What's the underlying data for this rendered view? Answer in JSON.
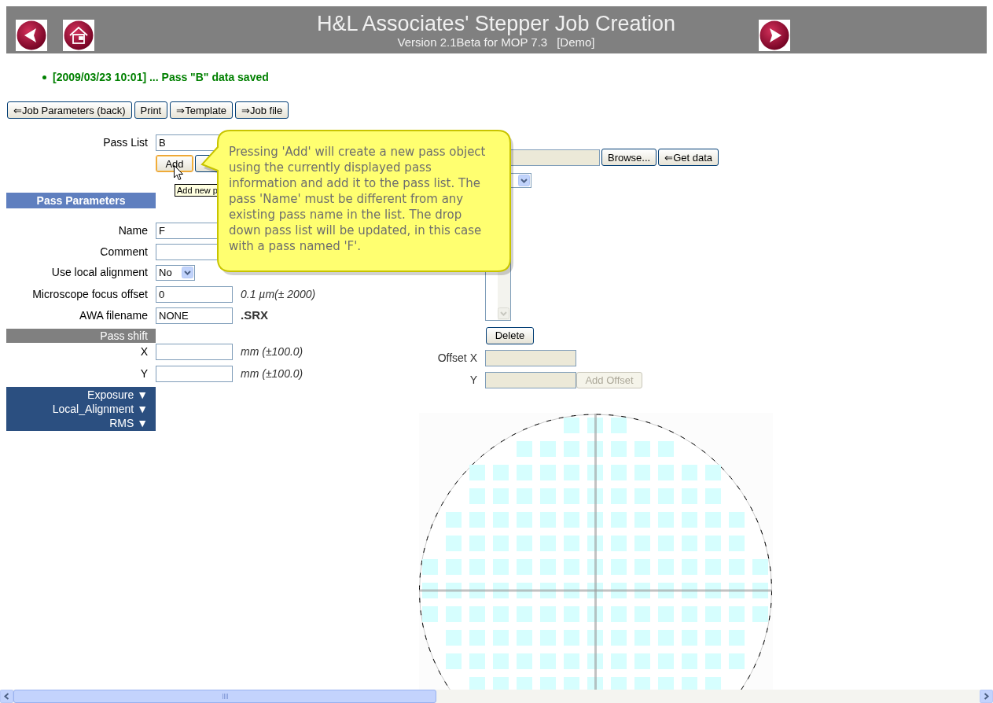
{
  "header": {
    "title": "H&L Associates' Stepper Job Creation",
    "subtitle": "Version 2.1Beta for MOP 7.3",
    "mode": "[Demo]"
  },
  "messages": [
    "[2009/03/23 10:01] ... Pass \"B\" data saved"
  ],
  "toolbar": [
    "⇐Job Parameters (back)",
    "Print",
    "⇒Template",
    "⇒Job file"
  ],
  "pass_list": {
    "label": "Pass List",
    "value": "B"
  },
  "add_button": {
    "label": "Add",
    "focused": true
  },
  "hover_tooltip": "Add new p",
  "callout": "Pressing 'Add' will create a new pass object using the currently displayed pass information and add it to the pass list. The pass 'Name' must be different from any existing pass name in the list. The drop down pass list will be updated, in this case with a pass named 'F'.",
  "pass_parameters": {
    "title": "Pass Parameters",
    "fields": [
      {
        "kind": "text",
        "label": "Name",
        "value": "F"
      },
      {
        "kind": "text",
        "label": "Comment"
      },
      {
        "kind": "select",
        "label": "Use local alignment",
        "value": "No"
      },
      {
        "kind": "text",
        "label": "Microscope focus offset",
        "value": "0",
        "unit": "0.1 µm(± 2000)",
        "unit_italic": true,
        "unit_bold": false
      },
      {
        "kind": "text",
        "label": "AWA filename",
        "value": "NONE",
        "unit": ".SRX",
        "unit_italic": false,
        "unit_bold": true
      }
    ]
  },
  "pass_shift": {
    "title": "Pass shift",
    "fields": [
      {
        "label": "X",
        "unit": "mm (±100.0)"
      },
      {
        "label": "Y",
        "unit": "mm (±100.0)"
      }
    ]
  },
  "sections": [
    "Exposure ▼",
    "Local_Alignment ▼",
    "RMS ▼"
  ],
  "file_row": {
    "disabled": true,
    "buttons": [
      "Browse...",
      "⇐Get data"
    ]
  },
  "delete_button": "Delete",
  "offset": {
    "rows": [
      {
        "label": "Offset X",
        "disabled": true
      },
      {
        "label": "Y",
        "disabled": true
      }
    ],
    "add_button": {
      "label": "Add Offset",
      "disabled": true
    }
  }
}
